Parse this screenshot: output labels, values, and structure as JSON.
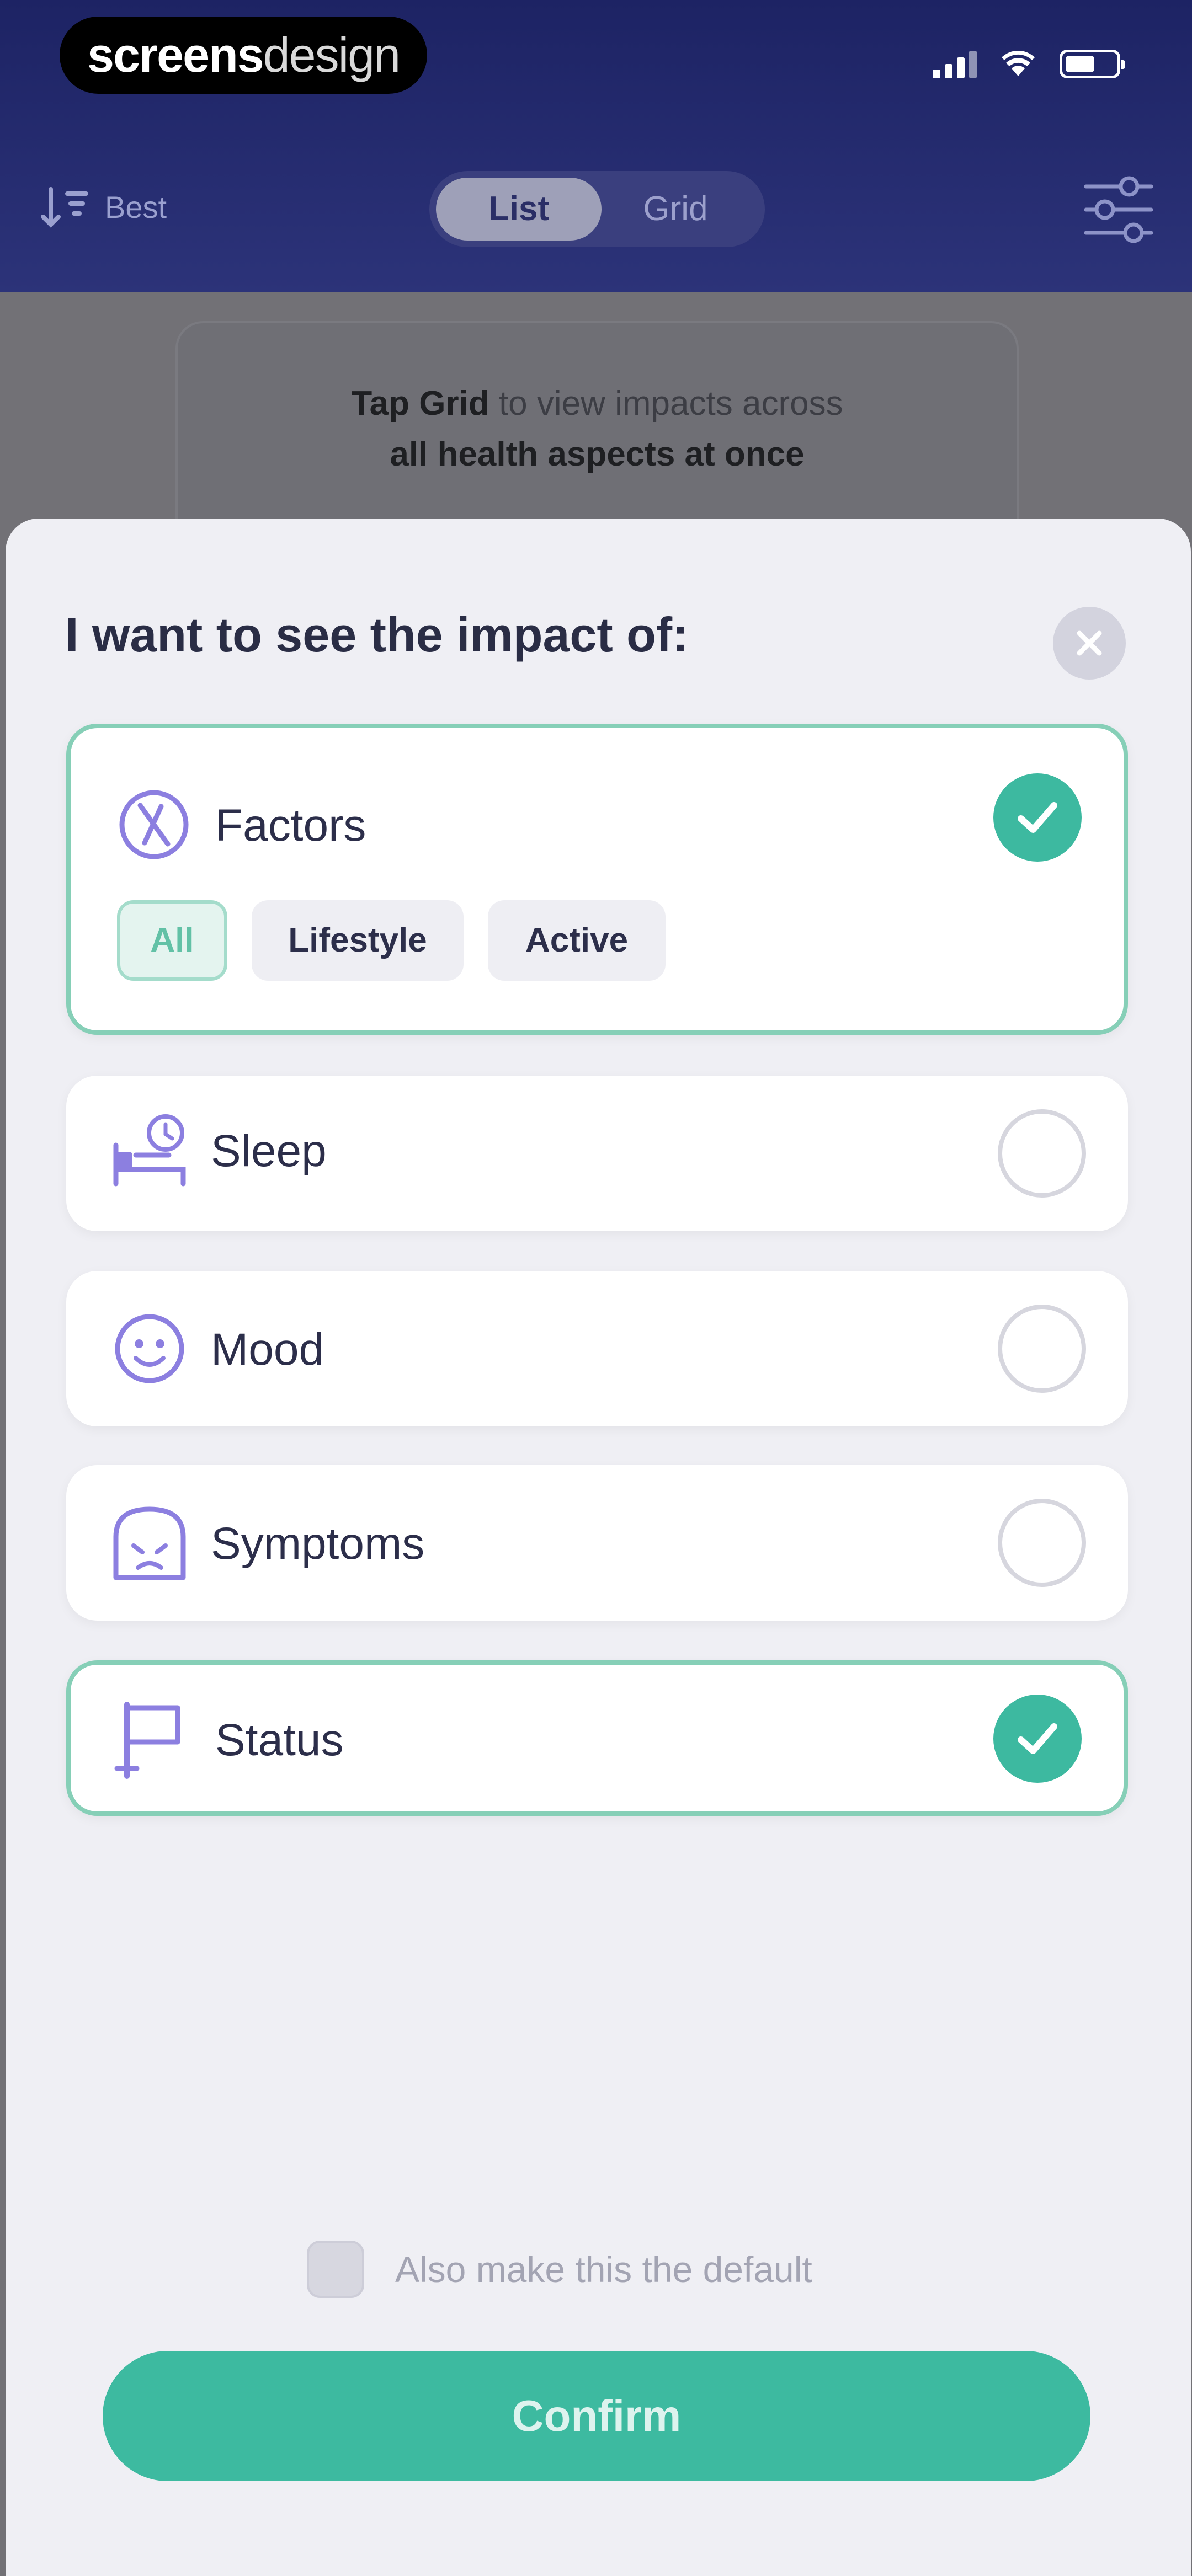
{
  "status_bar": {
    "brand_bold": "screens",
    "brand_light": "design"
  },
  "toolbar": {
    "sort_label": "Best",
    "view_toggle": {
      "active": "List",
      "inactive": "Grid"
    }
  },
  "tooltip": {
    "line1_bold": "Tap Grid",
    "line1_rest": " to view impacts across",
    "line2": "all health aspects at once"
  },
  "sheet": {
    "title": "I want to see the impact of:",
    "options": [
      {
        "label": "Factors",
        "icon": "factors-icon",
        "selected": true,
        "chips": [
          "All",
          "Lifestyle",
          "Active"
        ],
        "active_chip": "All"
      },
      {
        "label": "Sleep",
        "icon": "sleep-icon",
        "selected": false
      },
      {
        "label": "Mood",
        "icon": "mood-icon",
        "selected": false
      },
      {
        "label": "Symptoms",
        "icon": "symptoms-icon",
        "selected": false
      },
      {
        "label": "Status",
        "icon": "flag-icon",
        "selected": true
      }
    ],
    "default_label": "Also make this the default",
    "default_checked": false,
    "confirm_label": "Confirm"
  },
  "colors": {
    "accent": "#3db9a0",
    "accent_border": "#86cfb7",
    "icon": "#8c7fe0",
    "header": "#1d2364"
  }
}
